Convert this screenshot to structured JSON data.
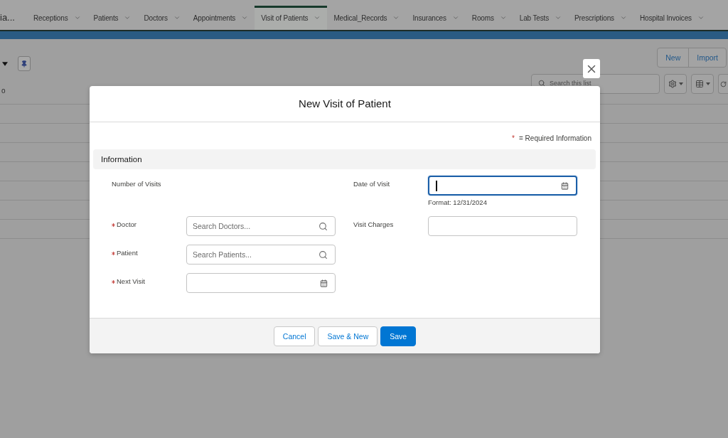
{
  "app": {
    "title": "ia..."
  },
  "nav_tabs": [
    {
      "label": "Receptions",
      "selected": false
    },
    {
      "label": "Patients",
      "selected": false
    },
    {
      "label": "Doctors",
      "selected": false
    },
    {
      "label": "Appointments",
      "selected": false
    },
    {
      "label": "Visit of Patients",
      "selected": true
    },
    {
      "label": "Medical_Records",
      "selected": false
    },
    {
      "label": "Insurances",
      "selected": false
    },
    {
      "label": "Rooms",
      "selected": false
    },
    {
      "label": "Lab Tests",
      "selected": false
    },
    {
      "label": "Prescriptions",
      "selected": false
    },
    {
      "label": "Hospital Invoices",
      "selected": false
    }
  ],
  "list_view": {
    "status_text": "o",
    "actions": [
      {
        "label": "New"
      },
      {
        "label": "Import"
      }
    ],
    "search": {
      "placeholder": "Search this list"
    }
  },
  "modal": {
    "title": "New Visit of Patient",
    "required_note": {
      "marker": "*",
      "text": "= Required Information"
    },
    "section_title": "Information",
    "rows": [
      [
        {
          "label": "Number of Visits",
          "kind": "display",
          "required": false
        },
        {
          "label": "Date of Visit",
          "kind": "date",
          "required": false,
          "focused": true,
          "help": "Format: 12/31/2024"
        }
      ],
      [
        {
          "label": "Doctor",
          "kind": "lookup",
          "required": true,
          "focused": false,
          "placeholder": "Search Doctors..."
        },
        {
          "label": "Visit Charges",
          "kind": "text",
          "required": false,
          "focused": false
        }
      ],
      [
        {
          "label": "Patient",
          "kind": "lookup",
          "required": true,
          "focused": false,
          "placeholder": "Search Patients..."
        }
      ],
      [
        {
          "label": "Next Visit",
          "kind": "date",
          "required": true,
          "focused": false
        }
      ]
    ],
    "buttons": [
      {
        "label": "Cancel",
        "kind": "neutral"
      },
      {
        "label": "Save & New",
        "kind": "neutral"
      },
      {
        "label": "Save",
        "kind": "brand"
      }
    ]
  }
}
